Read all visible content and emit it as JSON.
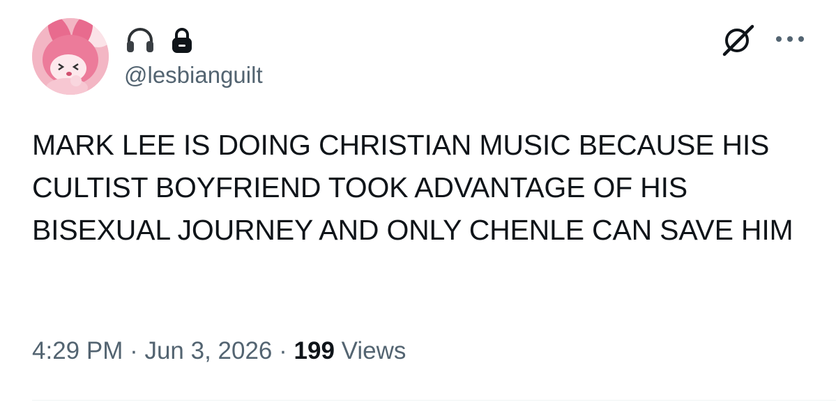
{
  "user": {
    "handle": "@lesbianguilt",
    "avatar_icon": "pink-bunny-avatar",
    "badge_icons": [
      "headphones-icon",
      "lock-icon"
    ]
  },
  "actions": {
    "grok_icon": "grok-icon",
    "more_icon": "more-icon",
    "more_label": "···"
  },
  "tweet": {
    "text": "MARK LEE IS DOING CHRISTIAN MUSIC BECAUSE HIS CULTIST BOYFRIEND TOOK ADVANTAGE OF HIS BISEXUAL JOURNEY AND ONLY CHENLE CAN SAVE HIM"
  },
  "meta": {
    "time": "4:29 PM",
    "separator": " · ",
    "date": "Jun 3, 2026",
    "views_count": "199",
    "views_label": " Views"
  },
  "colors": {
    "text": "#0f1419",
    "secondary": "#536471",
    "divider": "#eff3f4"
  }
}
